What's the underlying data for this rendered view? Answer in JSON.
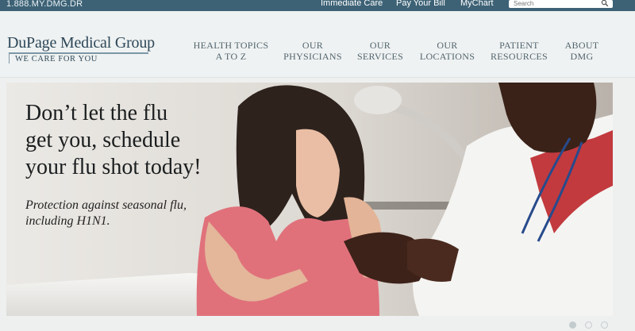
{
  "topbar": {
    "phone": "1.888.MY.DMG.DR",
    "links": [
      "Immediate Care",
      "Pay Your Bill",
      "MyChart"
    ],
    "search_placeholder": "Search"
  },
  "logo": {
    "name": "DuPage Medical Group",
    "tagline": "WE CARE FOR YOU"
  },
  "nav": [
    {
      "line1": "HEALTH TOPICS",
      "line2": "A TO Z"
    },
    {
      "line1": "OUR",
      "line2": "PHYSICIANS"
    },
    {
      "line1": "OUR",
      "line2": "SERVICES"
    },
    {
      "line1": "OUR",
      "line2": "LOCATIONS"
    },
    {
      "line1": "PATIENT",
      "line2": "RESOURCES"
    },
    {
      "line1": "ABOUT",
      "line2": "DMG"
    }
  ],
  "hero": {
    "headline": [
      "Don’t let the flu",
      "get you, schedule",
      "your flu shot today!"
    ],
    "subtext": [
      "Protection against seasonal flu,",
      "including H1N1."
    ]
  },
  "slider": {
    "count": 3,
    "active_index": 0
  },
  "colors": {
    "topbar_bg": "#3d6276",
    "header_bg": "#eff2f2",
    "logo_text": "#2d4758",
    "nav_text": "#52646e",
    "dot": "#c3cbcd"
  }
}
